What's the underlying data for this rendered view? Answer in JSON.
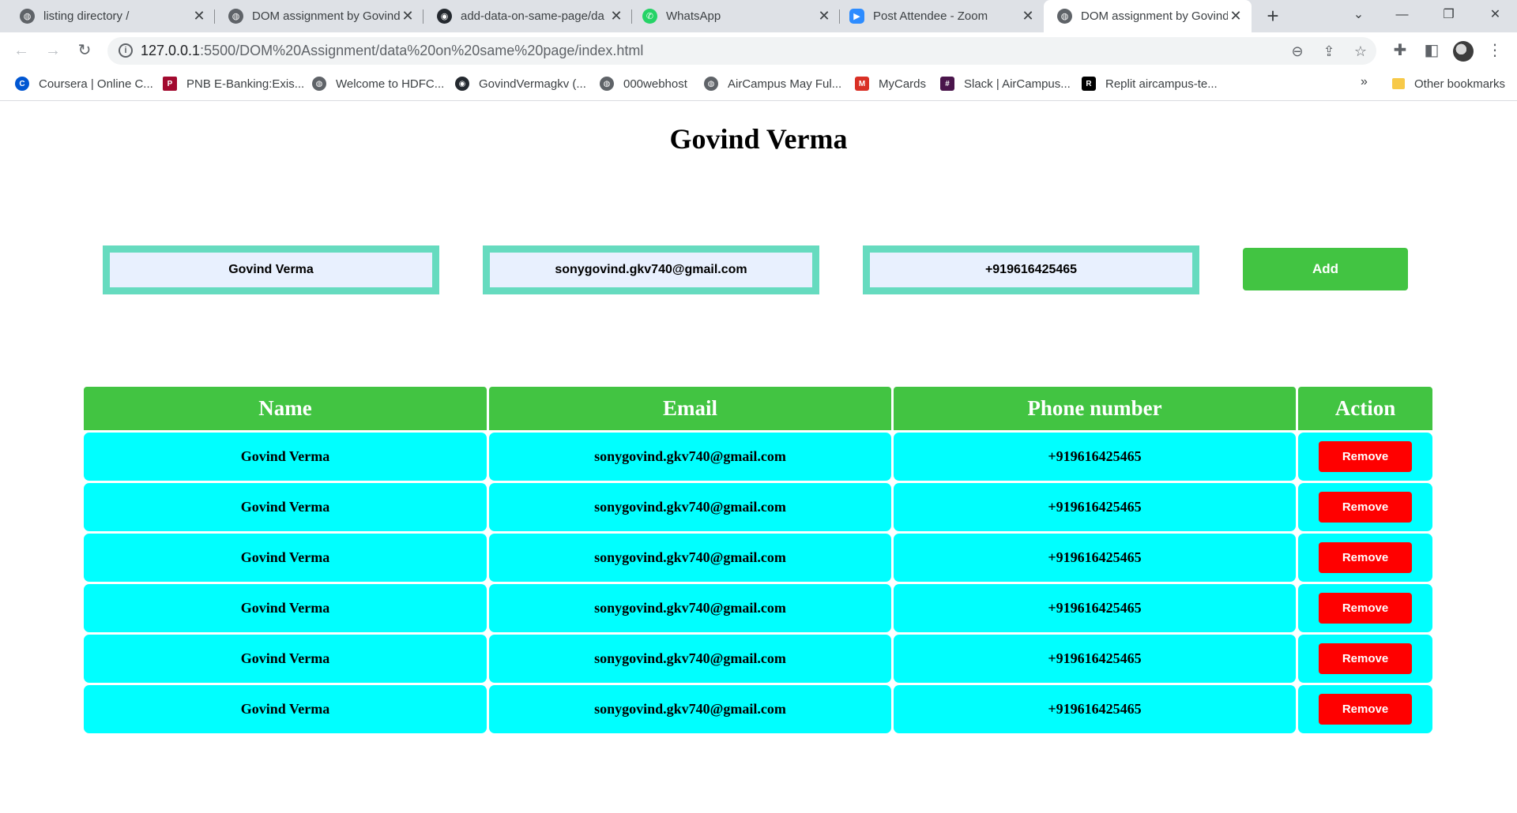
{
  "browser": {
    "tabs": [
      {
        "title": "listing directory /",
        "icon": "globe-icon",
        "active": false
      },
      {
        "title": "DOM assignment by Govind",
        "icon": "globe-icon",
        "active": false
      },
      {
        "title": "add-data-on-same-page/da",
        "icon": "github-icon",
        "active": false
      },
      {
        "title": "WhatsApp",
        "icon": "whatsapp-icon",
        "active": false
      },
      {
        "title": "Post Attendee - Zoom",
        "icon": "zoom-icon",
        "active": false
      },
      {
        "title": "DOM assignment by Govind",
        "icon": "globe-icon",
        "active": true
      }
    ],
    "new_tab_label": "+",
    "url_host": "127.0.0.1",
    "url_rest": ":5500/DOM%20Assignment/data%20on%20same%20page/index.html",
    "bookmarks": [
      {
        "label": "Coursera | Online C...",
        "icon": "coursera-icon",
        "color": "#0056d2"
      },
      {
        "label": "PNB E-Banking:Exis...",
        "icon": "pnb-icon",
        "color": "#a20a2f"
      },
      {
        "label": "Welcome to HDFC...",
        "icon": "globe-icon",
        "color": "#5f6368"
      },
      {
        "label": "GovindVermagkv (...",
        "icon": "github-icon",
        "color": "#24292f"
      },
      {
        "label": "000webhost",
        "icon": "globe-icon",
        "color": "#5f6368"
      },
      {
        "label": "AirCampus May Ful...",
        "icon": "globe-icon",
        "color": "#5f6368"
      },
      {
        "label": "MyCards",
        "icon": "mycards-icon",
        "color": "#d93025"
      },
      {
        "label": "Slack | AirCampus...",
        "icon": "slack-icon",
        "color": "#4a154b"
      },
      {
        "label": "Replit aircampus-te...",
        "icon": "replit-icon",
        "color": "#000000"
      }
    ],
    "more_bookmarks": "»",
    "other_bookmarks": "Other bookmarks"
  },
  "page": {
    "title": "Govind Verma",
    "form": {
      "name_value": "Govind Verma",
      "email_value": "sonygovind.gkv740@gmail.com",
      "phone_value": "+919616425465",
      "add_label": "Add"
    },
    "table": {
      "headers": [
        "Name",
        "Email",
        "Phone number",
        "Action"
      ],
      "remove_label": "Remove",
      "rows": [
        {
          "name": "Govind Verma",
          "email": "sonygovind.gkv740@gmail.com",
          "phone": "+919616425465"
        },
        {
          "name": "Govind Verma",
          "email": "sonygovind.gkv740@gmail.com",
          "phone": "+919616425465"
        },
        {
          "name": "Govind Verma",
          "email": "sonygovind.gkv740@gmail.com",
          "phone": "+919616425465"
        },
        {
          "name": "Govind Verma",
          "email": "sonygovind.gkv740@gmail.com",
          "phone": "+919616425465"
        },
        {
          "name": "Govind Verma",
          "email": "sonygovind.gkv740@gmail.com",
          "phone": "+919616425465"
        },
        {
          "name": "Govind Verma",
          "email": "sonygovind.gkv740@gmail.com",
          "phone": "+919616425465"
        }
      ]
    },
    "colors": {
      "header_green": "#42c442",
      "cell_cyan": "#00ffff",
      "field_border": "#66dbbf",
      "remove_red": "#ff0000"
    }
  }
}
